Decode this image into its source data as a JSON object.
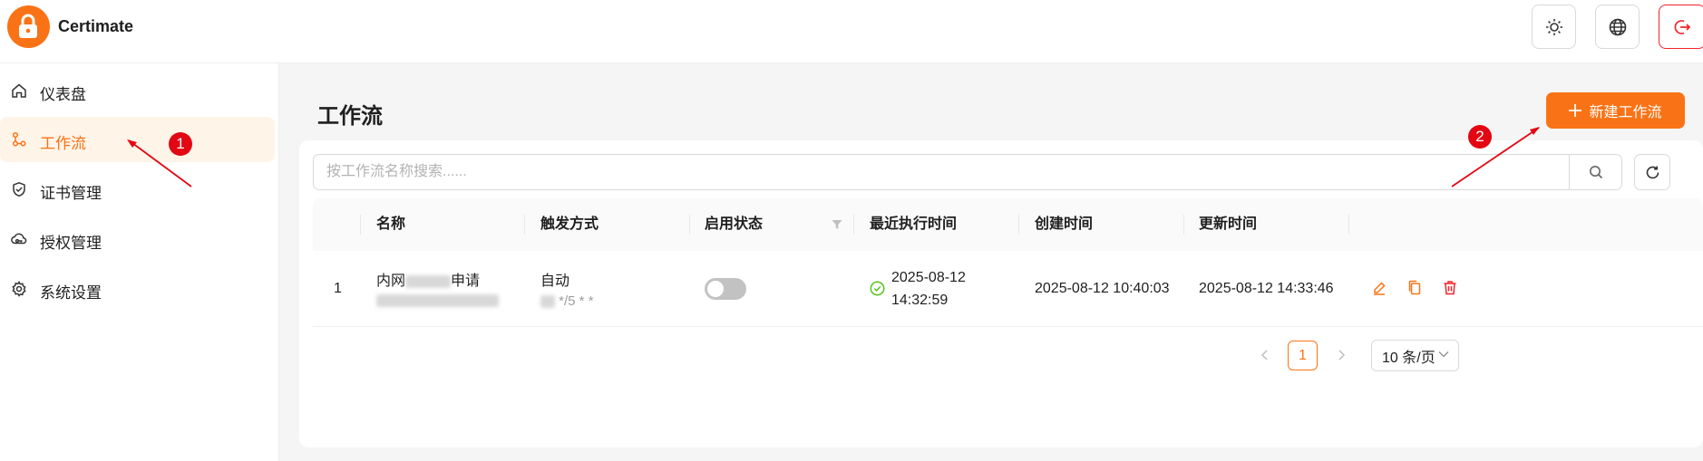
{
  "header": {
    "app_name": "Certimate",
    "buttons": [
      "sun-icon",
      "globe-icon",
      "logout-icon"
    ]
  },
  "sidebar": {
    "items": [
      {
        "label": "仪表盘",
        "icon": "home-icon",
        "active": false
      },
      {
        "label": "工作流",
        "icon": "workflow-icon",
        "active": true
      },
      {
        "label": "证书管理",
        "icon": "shield-check-icon",
        "active": false
      },
      {
        "label": "授权管理",
        "icon": "cloud-key-icon",
        "active": false
      },
      {
        "label": "系统设置",
        "icon": "gear-icon",
        "active": false
      }
    ]
  },
  "main": {
    "title": "工作流",
    "new_button_label": "新建工作流",
    "search": {
      "placeholder": "按工作流名称搜索......",
      "value": ""
    },
    "table": {
      "columns": [
        "名称",
        "触发方式",
        "启用状态",
        "最近执行时间",
        "创建时间",
        "更新时间"
      ],
      "rows": [
        {
          "index": "1",
          "name": "内网",
          "name_suffix": "申请",
          "trigger": "自动",
          "trigger_sub": "*/5 * *",
          "enabled": false,
          "last_run_date": "2025-08-12",
          "last_run_time": "14:32:59",
          "last_run_status": "success",
          "created": "2025-08-12 10:40:03",
          "updated": "2025-08-12 14:33:46"
        }
      ]
    },
    "pagination": {
      "current": "1",
      "page_size": "10 条/页"
    }
  },
  "annotations": [
    {
      "number": "1"
    },
    {
      "number": "2"
    }
  ],
  "colors": {
    "accent": "#f97316",
    "active_bg": "#fff4e8",
    "annotation": "#e30613",
    "success": "#52c41a"
  }
}
